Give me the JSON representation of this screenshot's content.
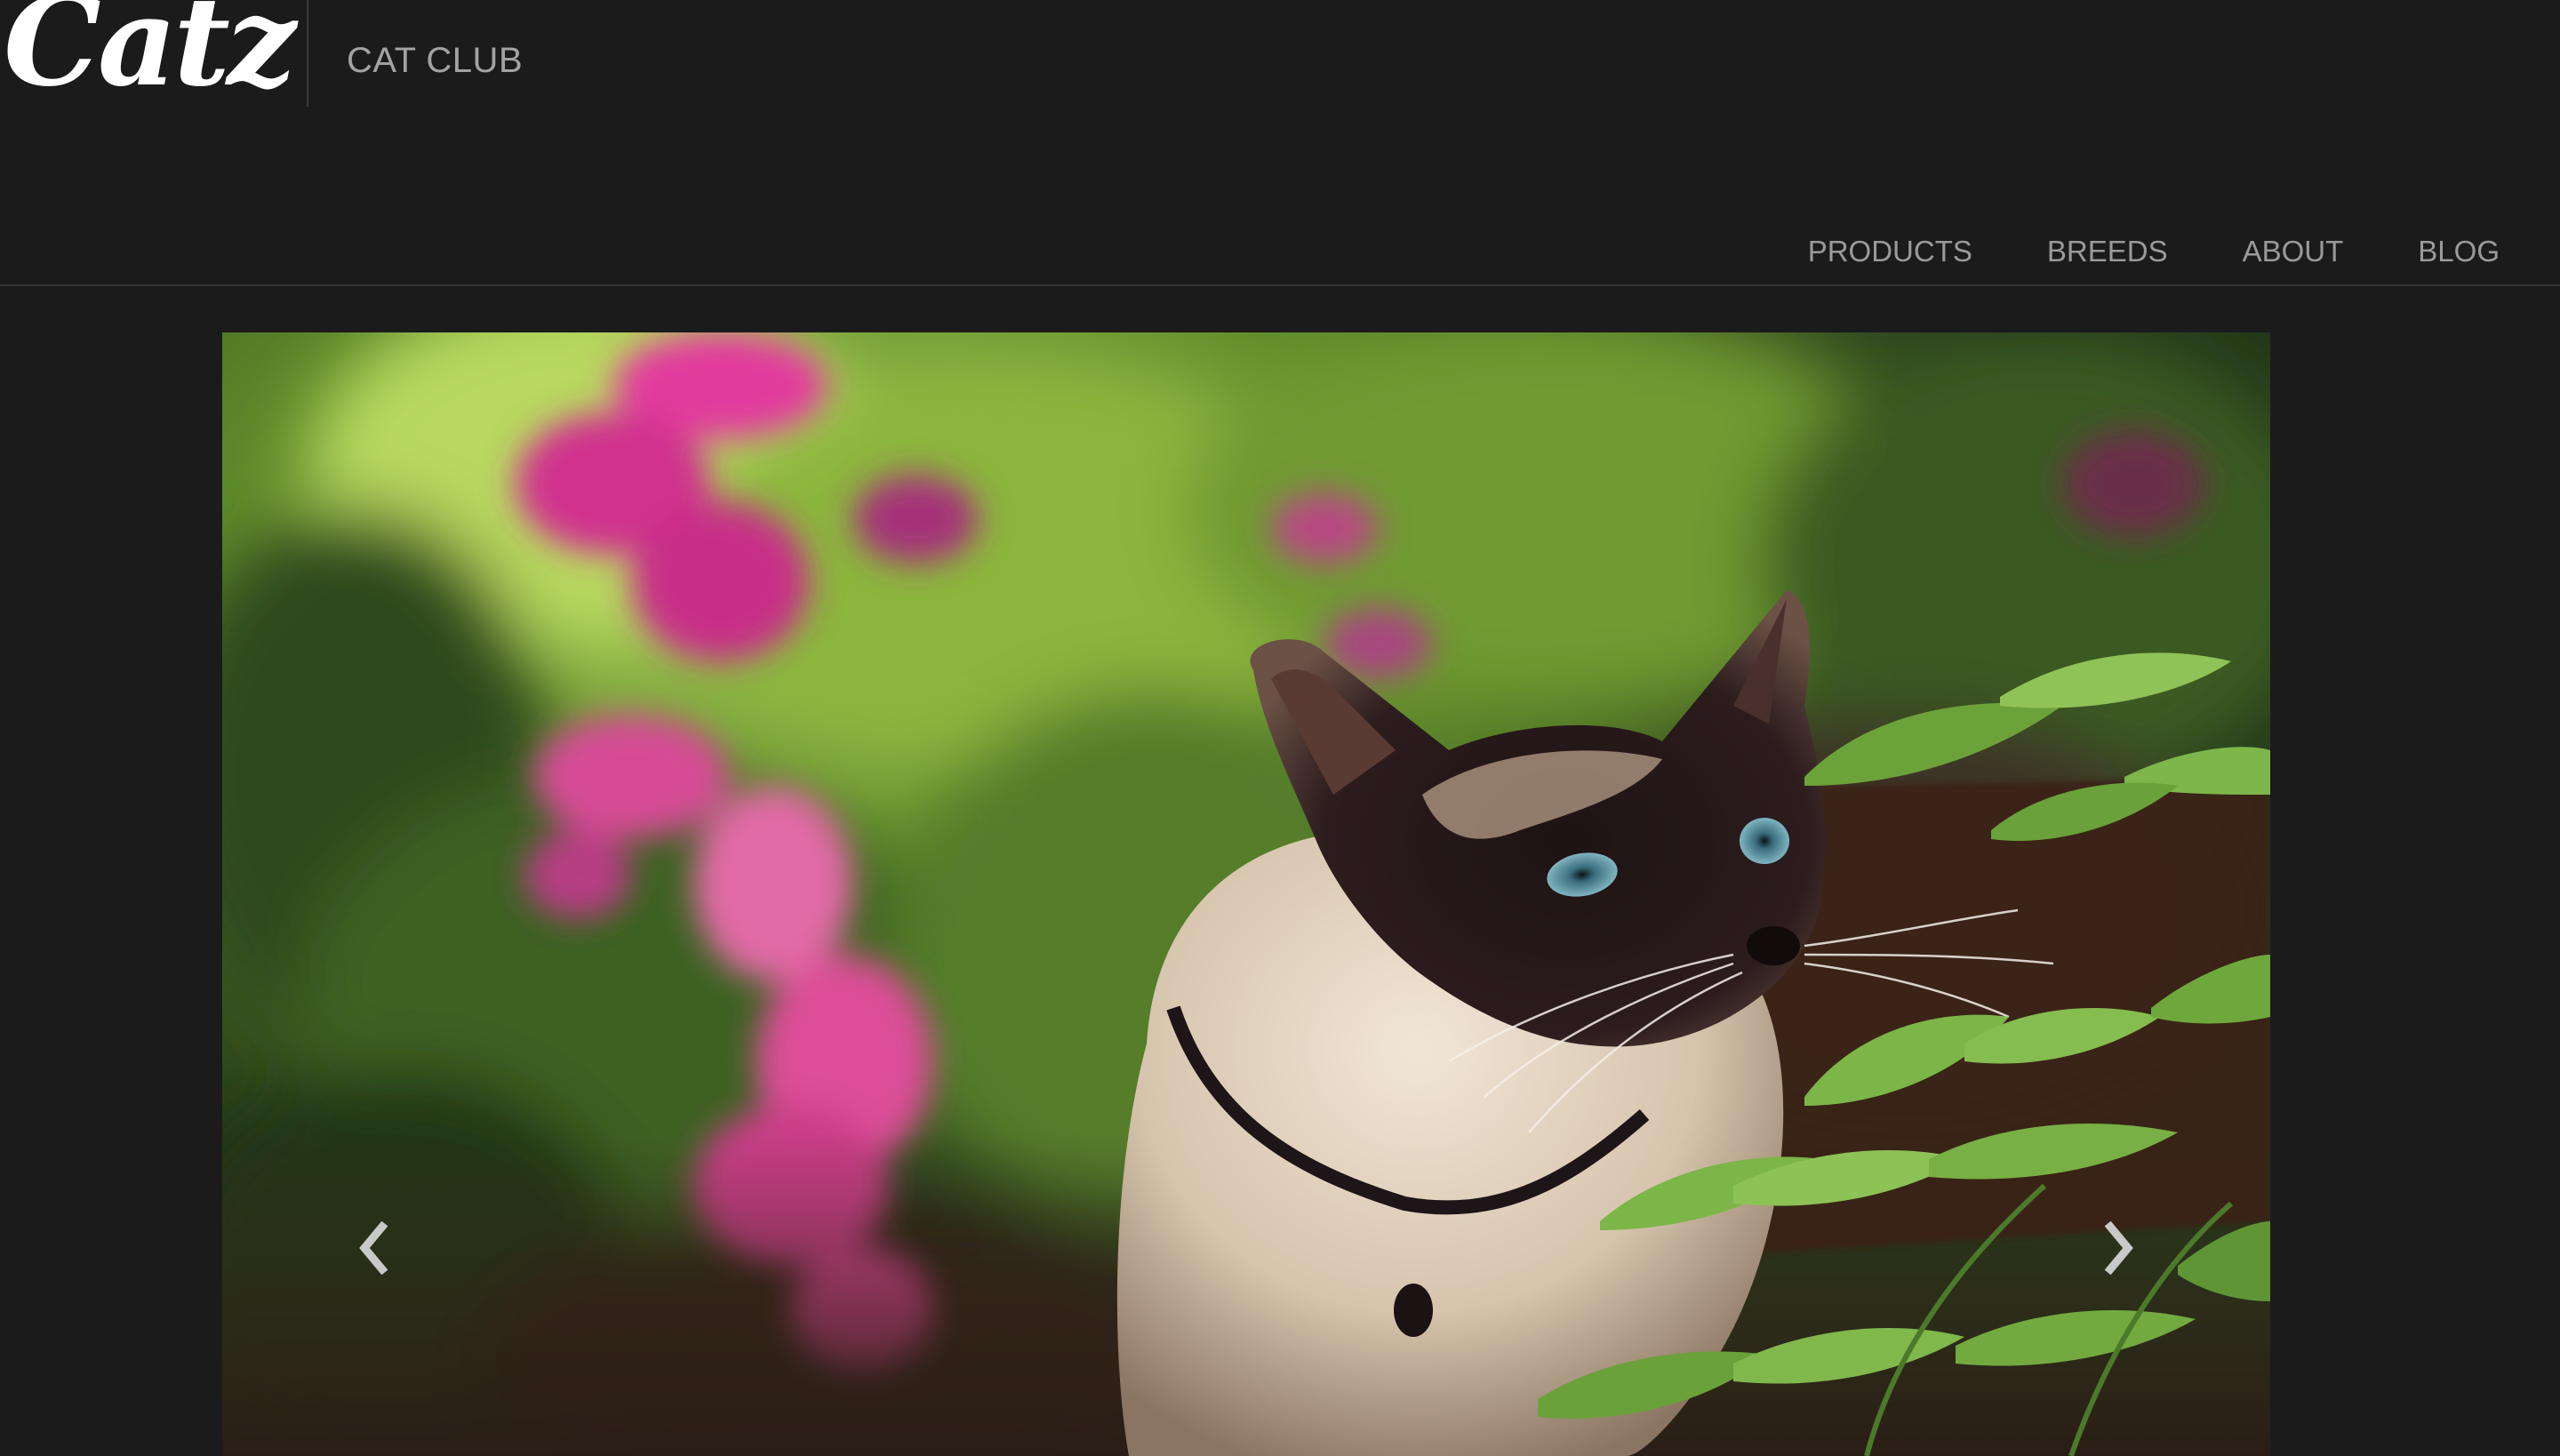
{
  "header": {
    "logo_text": "Catz",
    "site_title": "CAT CLUB"
  },
  "nav": {
    "items": [
      "PRODUCTS",
      "BREEDS",
      "ABOUT",
      "BLOG"
    ]
  },
  "carousel": {
    "image_alt": "Siamese cat among green leaves and pink flowers",
    "prev_icon": "chevron-left-icon",
    "next_icon": "chevron-right-icon"
  },
  "colors": {
    "background": "#1b1b1c",
    "logo": "#ffffff",
    "nav_text": "#9a9a9a",
    "divider": "#343436"
  }
}
